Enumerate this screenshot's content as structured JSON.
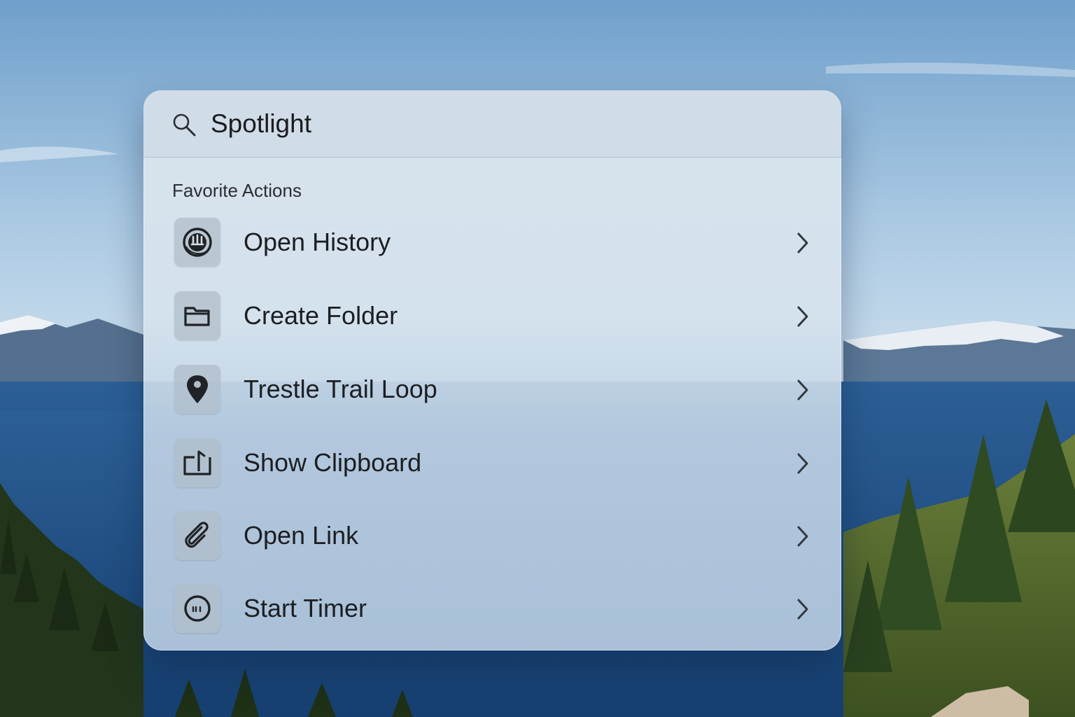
{
  "spotlight": {
    "query": "Spotlight",
    "section_title": "Favorite Actions",
    "items": [
      {
        "label": "Open History",
        "icon": "history-icon"
      },
      {
        "label": "Create Folder",
        "icon": "folder-icon"
      },
      {
        "label": "Trestle Trail Loop",
        "icon": "map-pin-icon"
      },
      {
        "label": "Show Clipboard",
        "icon": "clipboard-icon"
      },
      {
        "label": "Open Link",
        "icon": "paperclip-icon"
      },
      {
        "label": "Start Timer",
        "icon": "timer-icon"
      }
    ]
  },
  "colors": {
    "sky": "#6f9fcb",
    "lake": "#1f4f87",
    "forest": "#2f4a22",
    "panel": "#d6e3ee",
    "text": "#1c1e21"
  }
}
